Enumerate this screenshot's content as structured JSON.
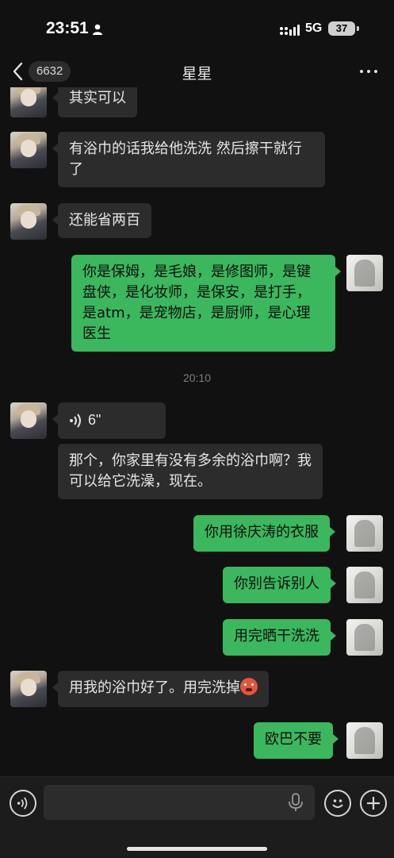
{
  "status_bar": {
    "time": "23:51",
    "network": "5G",
    "battery": "37"
  },
  "nav": {
    "unread_count": "6632",
    "title": "星星"
  },
  "messages": [
    {
      "side": "in",
      "text": "其实可以"
    },
    {
      "side": "in",
      "text": "有浴巾的话我给他洗洗 然后擦干就行了"
    },
    {
      "side": "in",
      "text": "还能省两百"
    },
    {
      "side": "out",
      "text": "你是保姆，是毛娘，是修图师，是键盘侠，是化妆师，是保安，是打手，是atm，是宠物店，是厨师，是心理医生"
    },
    {
      "timestamp": "20:10"
    },
    {
      "side": "in",
      "type": "voice",
      "duration": "6\""
    },
    {
      "side": "in",
      "text": "那个，你家里有没有多余的浴巾啊？我可以给它洗澡，现在。"
    },
    {
      "side": "out",
      "text": "你用徐庆涛的衣服"
    },
    {
      "side": "out",
      "text": "你别告诉别人"
    },
    {
      "side": "out",
      "text": "用完晒干洗洗"
    },
    {
      "side": "in",
      "text": "用我的浴巾好了。用完洗掉",
      "emoji": "hot-face"
    },
    {
      "side": "out",
      "text": "欧巴不要"
    }
  ],
  "colors": {
    "outgoing_bubble": "#3bb75e",
    "incoming_bubble": "#2c2c2c",
    "background": "#111111"
  },
  "icons": [
    "back-chevron-icon",
    "more-dots-icon",
    "voice-wave-icon",
    "mic-icon",
    "emoji-face-icon",
    "plus-icon",
    "person-icon",
    "signal-icon"
  ]
}
